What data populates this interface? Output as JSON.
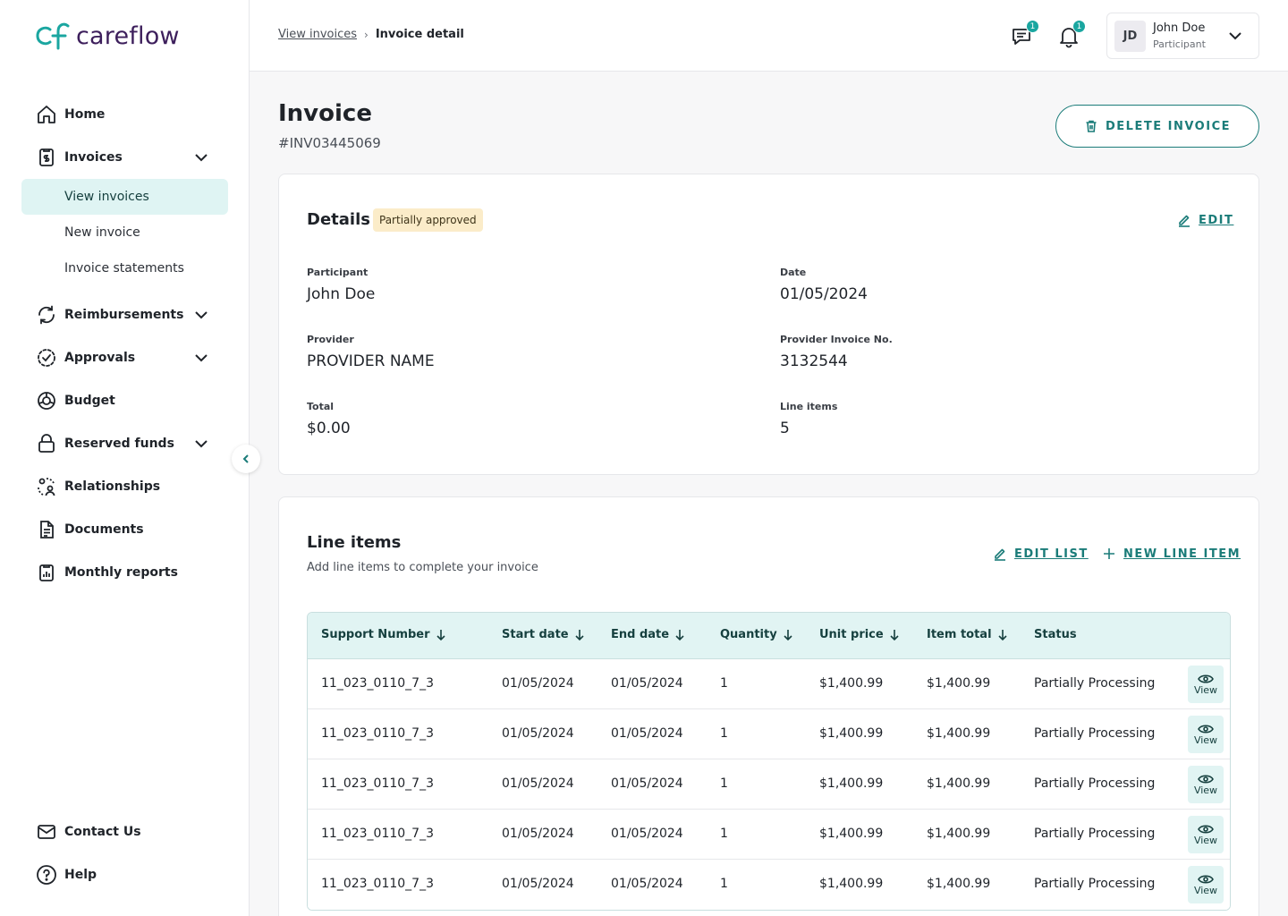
{
  "brand": {
    "name": "careflow",
    "color": "#1aa6a0"
  },
  "sidebar": {
    "items": [
      {
        "label": "Home",
        "icon": "home-icon"
      },
      {
        "label": "Invoices",
        "icon": "invoice-icon",
        "expanded": true,
        "children": [
          "View invoices",
          "New invoice",
          "Invoice statements"
        ]
      },
      {
        "label": "Reimbursements",
        "icon": "refresh-icon"
      },
      {
        "label": "Approvals",
        "icon": "check-circle-icon"
      },
      {
        "label": "Budget",
        "icon": "budget-icon"
      },
      {
        "label": "Reserved funds",
        "icon": "lock-icon"
      },
      {
        "label": "Relationships",
        "icon": "relationships-icon"
      },
      {
        "label": "Documents",
        "icon": "document-icon"
      },
      {
        "label": "Monthly reports",
        "icon": "report-icon"
      }
    ],
    "footer": [
      {
        "label": "Contact Us",
        "icon": "mail-icon"
      },
      {
        "label": "Help",
        "icon": "help-icon"
      }
    ]
  },
  "header": {
    "breadcrumb_link": "View invoices",
    "breadcrumb_sep": "›",
    "breadcrumb_current": "Invoice detail",
    "messages_count": "1",
    "notifications_count": "1",
    "user": {
      "initials": "JD",
      "name": "John Doe",
      "role": "Participant"
    }
  },
  "page": {
    "title": "Invoice",
    "invoice_number": "#INV03445069",
    "delete_label": "DELETE INVOICE"
  },
  "details": {
    "title": "Details",
    "status": "Partially approved",
    "edit_label": "EDIT",
    "fields": {
      "participant": {
        "label": "Participant",
        "value": "John Doe"
      },
      "date": {
        "label": "Date",
        "value": "01/05/2024"
      },
      "provider": {
        "label": "Provider",
        "value": "PROVIDER NAME"
      },
      "provider_invoice": {
        "label": "Provider Invoice No.",
        "value": "3132544"
      },
      "total": {
        "label": "Total",
        "value": "$0.00"
      },
      "line_items": {
        "label": "Line items",
        "value": "5"
      }
    }
  },
  "line_items": {
    "title": "Line items",
    "subtitle": "Add line items to complete your invoice",
    "edit_list_label": "EDIT LIST",
    "new_item_label": "NEW LINE ITEM",
    "columns": [
      "Support Number",
      "Start date",
      "End date",
      "Quantity",
      "Unit price",
      "Item total",
      "Status"
    ],
    "view_label": "View",
    "rows": [
      [
        "11_023_0110_7_3",
        "01/05/2024",
        "01/05/2024",
        "1",
        "$1,400.99",
        "$1,400.99",
        "Partially Processing"
      ],
      [
        "11_023_0110_7_3",
        "01/05/2024",
        "01/05/2024",
        "1",
        "$1,400.99",
        "$1,400.99",
        "Partially Processing"
      ],
      [
        "11_023_0110_7_3",
        "01/05/2024",
        "01/05/2024",
        "1",
        "$1,400.99",
        "$1,400.99",
        "Partially Processing"
      ],
      [
        "11_023_0110_7_3",
        "01/05/2024",
        "01/05/2024",
        "1",
        "$1,400.99",
        "$1,400.99",
        "Partially Processing"
      ],
      [
        "11_023_0110_7_3",
        "01/05/2024",
        "01/05/2024",
        "1",
        "$1,400.99",
        "$1,400.99",
        "Partially Processing"
      ]
    ]
  }
}
